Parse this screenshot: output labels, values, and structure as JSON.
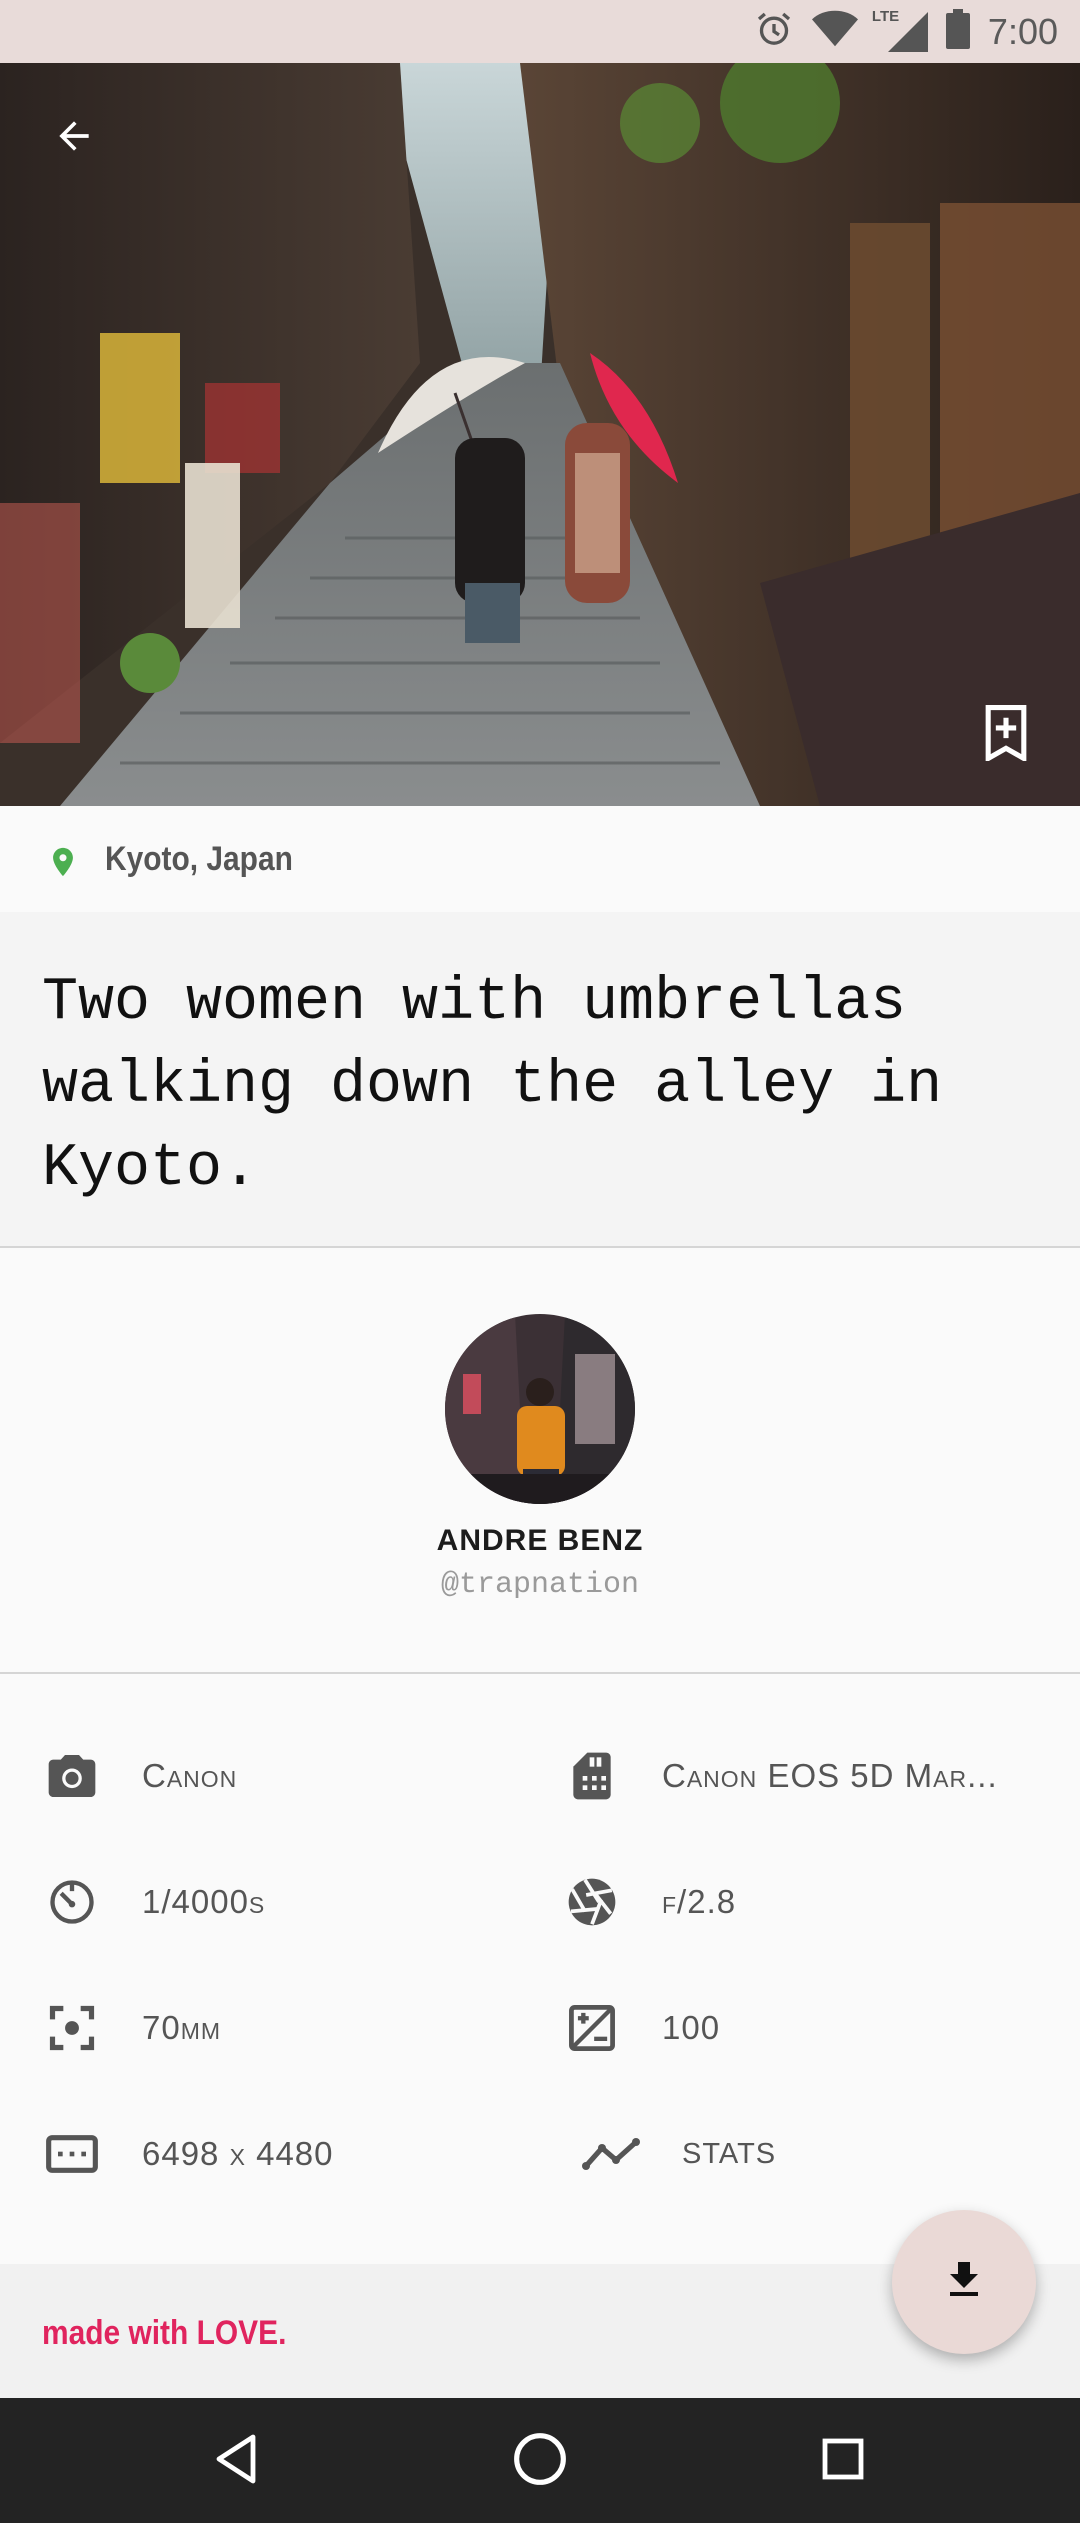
{
  "status_bar": {
    "time": "7:00",
    "network": "LTE",
    "icons": [
      "alarm-icon",
      "wifi-icon",
      "signal-icon",
      "battery-icon"
    ]
  },
  "hero": {
    "icons": [
      "back-arrow-icon",
      "bookmark-add-icon"
    ]
  },
  "location": {
    "text": "Kyoto, Japan",
    "icon": "location-pin-icon",
    "pin_color": "#4caf50"
  },
  "caption": {
    "text": "Two women with umbrellas walking down the alley in Kyoto."
  },
  "author": {
    "name": "ANDRE BENZ",
    "handle": "@trapnation"
  },
  "specs": [
    {
      "icon": "camera-icon",
      "label": "Canon"
    },
    {
      "icon": "sd-card-icon",
      "label": "Canon EOS 5D Mar..."
    },
    {
      "icon": "shutter-timer-icon",
      "label": "1/4000s"
    },
    {
      "icon": "aperture-icon",
      "label": "f/2.8"
    },
    {
      "icon": "focal-length-icon",
      "label": "70mm"
    },
    {
      "icon": "exposure-icon",
      "label": "100"
    },
    {
      "icon": "dimensions-icon",
      "label": "6498 x 4480"
    },
    {
      "icon": "stats-icon",
      "label": "STATS"
    }
  ],
  "footer": {
    "text": "made with LOVE.",
    "accent": "#e0245e"
  },
  "fab": {
    "icon": "download-icon"
  },
  "nav_bar": {
    "icons": [
      "back-triangle-icon",
      "home-circle-icon",
      "recents-square-icon"
    ]
  }
}
